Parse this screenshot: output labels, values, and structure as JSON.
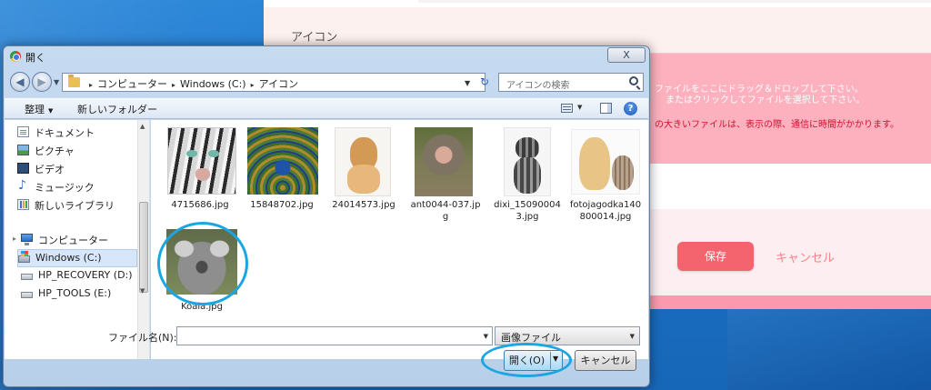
{
  "webpage": {
    "icon_section_label": "アイコン",
    "dropzone_line1": "ファイルをここにドラッグ＆ドロップして下さい。",
    "dropzone_line2": "またはクリックしてファイルを選択して下さい。",
    "dropzone_warning": "の大きいファイルは、表示の際、通信に時間がかかります。",
    "save_label": "保存",
    "cancel_label": "キャンセル"
  },
  "dialog": {
    "title": "開く",
    "close_label": "X",
    "address": {
      "crumbs": [
        "コンピューター",
        "Windows (C:)",
        "アイコン"
      ],
      "crumb_sep": "▸"
    },
    "search_placeholder": "アイコンの検索",
    "toolbar": {
      "organize_label": "整理",
      "organize_arrow": "▼",
      "new_folder_label": "新しいフォルダー",
      "help_label": "?"
    },
    "nav_items": [
      {
        "label": "ドキュメント",
        "icon": "document-icon"
      },
      {
        "label": "ピクチャ",
        "icon": "pictures-icon"
      },
      {
        "label": "ビデオ",
        "icon": "video-icon"
      },
      {
        "label": "ミュージック",
        "icon": "music-icon"
      },
      {
        "label": "新しいライブラリ",
        "icon": "library-icon"
      },
      {
        "label": "コンピューター",
        "icon": "computer-icon"
      },
      {
        "label": "Windows (C:)",
        "icon": "windows-drive-icon",
        "selected": true
      },
      {
        "label": "HP_RECOVERY (D:)",
        "icon": "drive-icon"
      },
      {
        "label": "HP_TOOLS (E:)",
        "icon": "drive-icon"
      }
    ],
    "files": [
      {
        "name": "4715686.jpg",
        "thumb": "tiger"
      },
      {
        "name": "15848702.jpg",
        "thumb": "peacock"
      },
      {
        "name": "24014573.jpg",
        "thumb": "puppy"
      },
      {
        "name": "ant0044-037.jpg",
        "thumb": "monkey"
      },
      {
        "name": "dixi_150900043.jpg",
        "thumb": "kitten"
      },
      {
        "name": "fotojagodka140800014.jpg",
        "thumb": "dog-and-cat"
      },
      {
        "name": "Koala.jpg",
        "thumb": "koala"
      }
    ],
    "filename_label": "ファイル名(N):",
    "filename_value": "",
    "filter_value": "画像ファイル",
    "open_label": "開く(O)",
    "cancel_label": "キャンセル"
  },
  "colors": {
    "highlight": "#1aa6e0",
    "save_button": "#f4646f",
    "dropzone": "#fdb1bf"
  }
}
